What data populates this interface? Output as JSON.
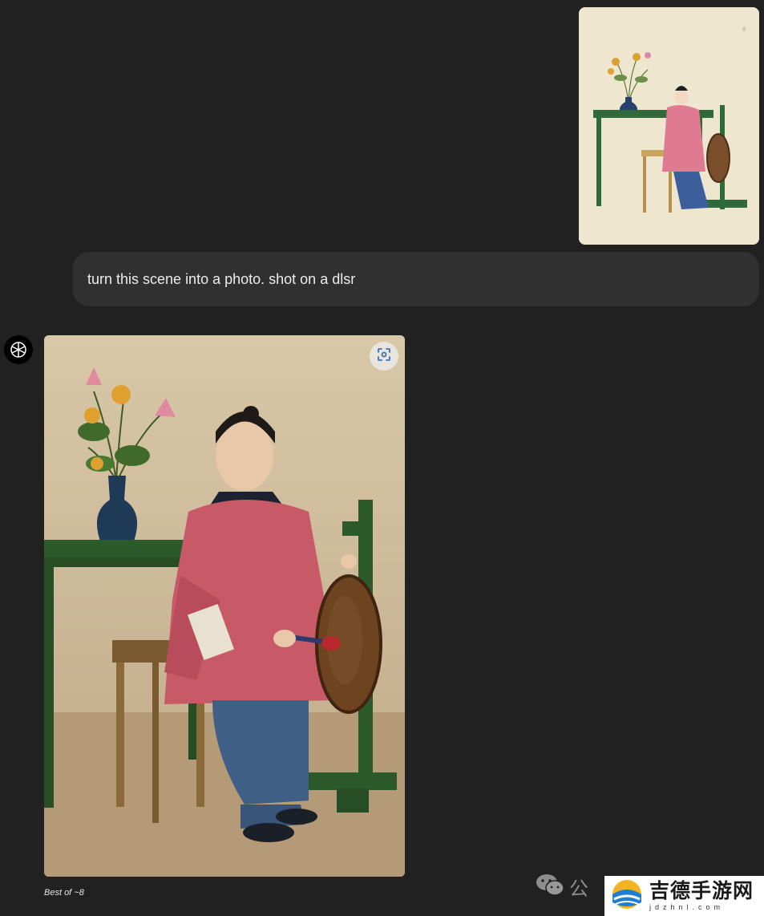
{
  "chat": {
    "user_message": "turn this scene into a photo. shot on a dlsr",
    "result_caption": "Best of ~8"
  },
  "icons": {
    "assistant_avatar": "openai-logo-icon",
    "select_area": "select-area-icon",
    "wechat": "wechat-icon"
  },
  "watermark": {
    "wechat_text": "公",
    "site_name": "吉德手游网",
    "site_domain": "jdzhnl.com"
  },
  "colors": {
    "background": "#212121",
    "bubble": "#303030",
    "text": "#ececec"
  }
}
